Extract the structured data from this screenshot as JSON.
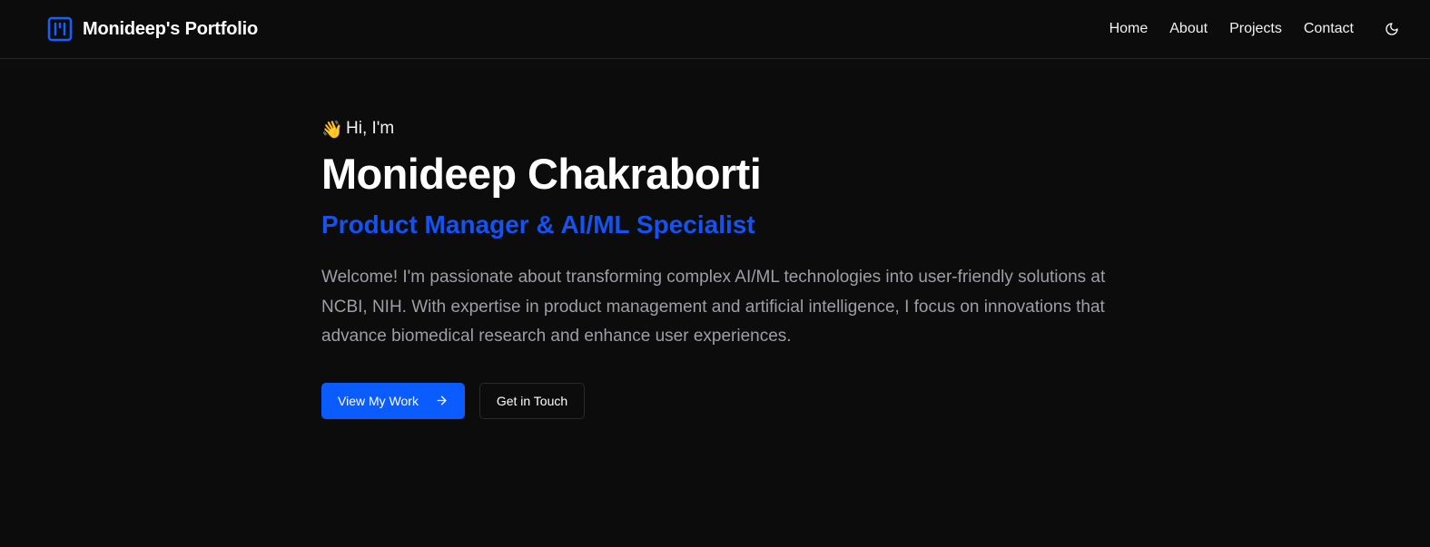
{
  "header": {
    "brand_name": "Monideep's Portfolio",
    "brand_icon": "kanban-square-icon",
    "nav_items": [
      {
        "label": "Home"
      },
      {
        "label": "About"
      },
      {
        "label": "Projects"
      },
      {
        "label": "Contact"
      }
    ],
    "theme_toggle_icon": "moon-icon"
  },
  "hero": {
    "greeting_emoji": "👋",
    "greeting": "Hi, I'm",
    "name": "Monideep Chakraborti",
    "role": "Product Manager & AI/ML Specialist",
    "description": "Welcome! I'm passionate about transforming complex AI/ML technologies into user-friendly solutions at NCBI, NIH. With expertise in product management and artificial intelligence, I focus on innovations that advance biomedical research and enhance user experiences.",
    "primary_cta": "View My Work",
    "primary_cta_icon": "arrow-right-icon",
    "secondary_cta": "Get in Touch"
  },
  "colors": {
    "background": "#0c0c0c",
    "accent": "#0b5cff",
    "role_text": "#1552f0",
    "muted_text": "#9e9ea6"
  }
}
